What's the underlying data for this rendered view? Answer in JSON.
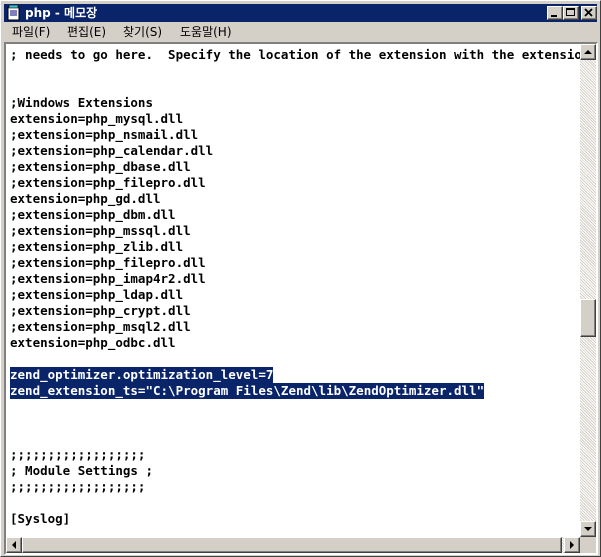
{
  "window": {
    "title": "php - 메모장",
    "icon": "notepad-icon"
  },
  "menu": [
    {
      "label": "파일(F)"
    },
    {
      "label": "편집(E)"
    },
    {
      "label": "찾기(S)"
    },
    {
      "label": "도움말(H)"
    }
  ],
  "editor": {
    "lines": [
      "; needs to go here.  Specify the location of the extension with the extension_dir directive",
      "",
      "",
      ";Windows Extensions",
      "extension=php_mysql.dll",
      ";extension=php_nsmail.dll",
      ";extension=php_calendar.dll",
      ";extension=php_dbase.dll",
      ";extension=php_filepro.dll",
      "extension=php_gd.dll",
      ";extension=php_dbm.dll",
      ";extension=php_mssql.dll",
      ";extension=php_zlib.dll",
      ";extension=php_filepro.dll",
      ";extension=php_imap4r2.dll",
      ";extension=php_ldap.dll",
      ";extension=php_crypt.dll",
      ";extension=php_msql2.dll",
      "extension=php_odbc.dll",
      "",
      "zend_optimizer.optimization_level=7",
      "zend_extension_ts=\"C:\\Program Files\\Zend\\lib\\ZendOptimizer.dll\"",
      "",
      "",
      "",
      ";;;;;;;;;;;;;;;;;;",
      "; Module Settings ;",
      ";;;;;;;;;;;;;;;;;;",
      "",
      "[Syslog]"
    ],
    "selected_lines": [
      20,
      21
    ]
  },
  "colors": {
    "selection": "#0a246a",
    "titlebar": "#0a246a",
    "face": "#d4d0c8"
  }
}
